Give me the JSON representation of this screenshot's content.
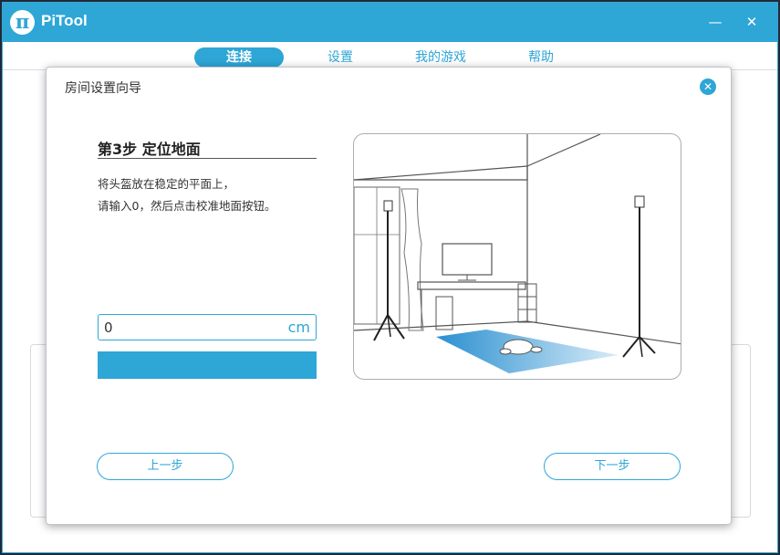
{
  "app": {
    "title": "PiTool",
    "logo_glyph": "π",
    "minimize_glyph": "—",
    "close_glyph": "✕"
  },
  "nav": {
    "tabs": [
      {
        "label": "连接",
        "active": true
      },
      {
        "label": "设置",
        "active": false
      },
      {
        "label": "我的游戏",
        "active": false
      },
      {
        "label": "帮助",
        "active": false
      }
    ]
  },
  "dialog": {
    "title": "房间设置向导",
    "close_glyph": "✕",
    "step_title": "第3步 定位地面",
    "description_line1": "将头盔放在稳定的平面上，",
    "description_line2": "请输入0，然后点击校准地面按钮。",
    "height_input_value": "0",
    "unit": "cm",
    "calibrate_button_label": "",
    "prev_button_label": "上一步",
    "next_button_label": "下一步"
  },
  "colors": {
    "accent": "#2ea6d6",
    "text": "#333333"
  }
}
